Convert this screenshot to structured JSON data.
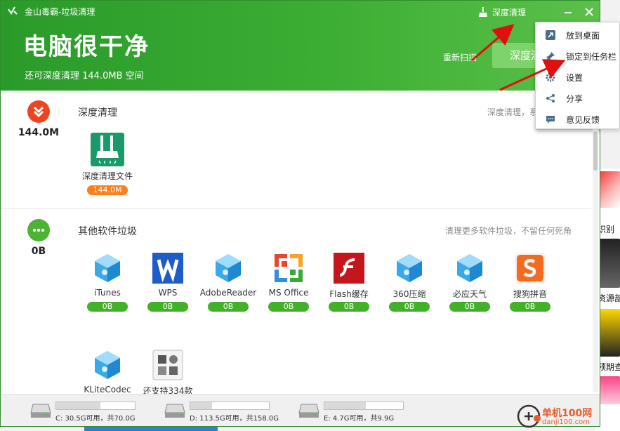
{
  "window": {
    "title": "金山毒霸-垃圾清理",
    "deep_clean_top_label": "深度清理",
    "headline": "电脑很干净",
    "subline": "还可深度清理 144.0MB 空间",
    "rescan_label": "重新扫描",
    "deep_clean_button": "深度清"
  },
  "sections": {
    "deep": {
      "size": "144.0M",
      "title": "深度清理",
      "desc": "深度清理，系统运行更",
      "items": [
        {
          "label": "深度清理文件",
          "badge": "144.0M"
        }
      ]
    },
    "other": {
      "size": "0B",
      "title": "其他软件垃圾",
      "desc": "清理更多软件垃圾，不留任何死角",
      "items": [
        {
          "label": "iTunes",
          "badge": "0B"
        },
        {
          "label": "WPS",
          "badge": "0B"
        },
        {
          "label": "AdobeReader",
          "badge": "0B"
        },
        {
          "label": "MS Office",
          "badge": "0B"
        },
        {
          "label": "Flash缓存",
          "badge": "0B"
        },
        {
          "label": "360压缩",
          "badge": "0B"
        },
        {
          "label": "必应天气",
          "badge": "0B"
        },
        {
          "label": "搜狗拼音",
          "badge": "0B"
        },
        {
          "label": "KLiteCodec",
          "badge": ""
        },
        {
          "label": "还支持334款",
          "badge": ""
        }
      ]
    }
  },
  "disks": [
    {
      "label": "C: 30.5G可用，共70.0G",
      "used_fraction": 0.56
    },
    {
      "label": "D: 113.5G可用，共158.0G",
      "used_fraction": 0.28
    },
    {
      "label": "E: 4.7G可用，共9.9G",
      "used_fraction": 0.53
    }
  ],
  "menu": {
    "items": [
      {
        "label": "放到桌面",
        "icon": "shortcut-icon"
      },
      {
        "label": "锁定到任务栏",
        "icon": "pin-icon"
      },
      {
        "label": "设置",
        "icon": "gear-icon"
      },
      {
        "label": "分享",
        "icon": "share-icon"
      },
      {
        "label": "意见反馈",
        "icon": "feedback-icon"
      }
    ]
  },
  "background": {
    "snippets": [
      "识别",
      "资源部",
      "预期查询"
    ]
  },
  "watermark": {
    "text": "单机100网",
    "sub": "danji100.com"
  },
  "colors": {
    "header_green": "#2a9a2a",
    "badge_green": "#43b02a",
    "badge_orange": "#ff7e1a",
    "deep_icon_red": "#ee4422",
    "other_icon_green": "#4cb431"
  }
}
